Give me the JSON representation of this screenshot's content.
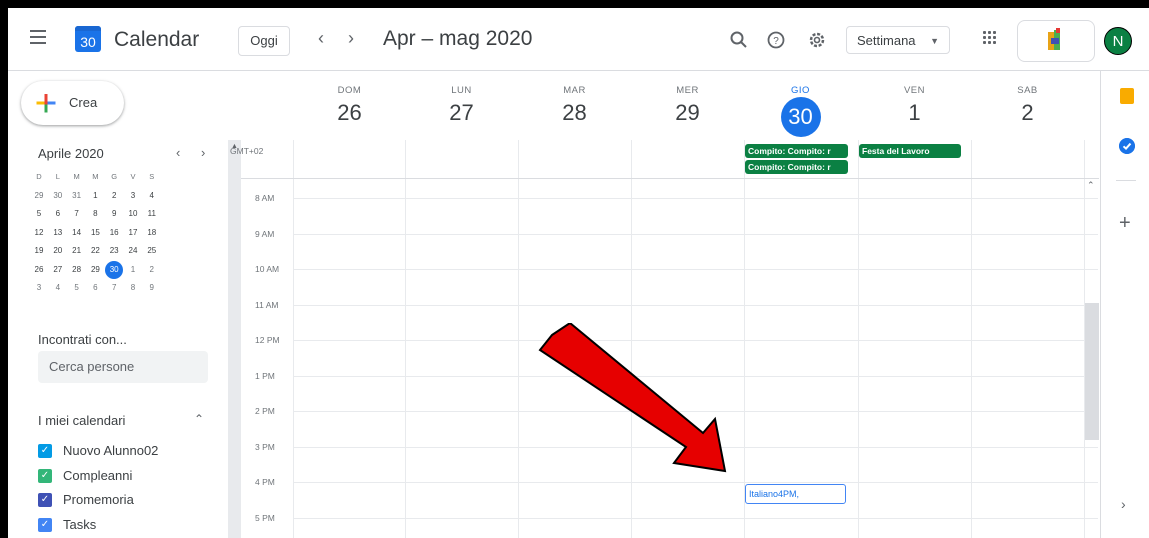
{
  "header": {
    "app_title": "Calendar",
    "logo_day": "30",
    "today_button": "Oggi",
    "prev_icon": "chevron-left-icon",
    "next_icon": "chevron-right-icon",
    "range_title": "Apr – mag 2020",
    "view_select": "Settimana",
    "avatar_letter": "N"
  },
  "sidebar": {
    "create_label": "Crea",
    "mini_month_title": "Aprile 2020",
    "mini_weekdays": [
      "D",
      "L",
      "M",
      "M",
      "G",
      "V",
      "S"
    ],
    "mini_weeks": [
      [
        "29",
        "30",
        "31",
        "1",
        "2",
        "3",
        "4"
      ],
      [
        "5",
        "6",
        "7",
        "8",
        "9",
        "10",
        "11"
      ],
      [
        "12",
        "13",
        "14",
        "15",
        "16",
        "17",
        "18"
      ],
      [
        "19",
        "20",
        "21",
        "22",
        "23",
        "24",
        "25"
      ],
      [
        "26",
        "27",
        "28",
        "29",
        "30",
        "1",
        "2"
      ],
      [
        "3",
        "4",
        "5",
        "6",
        "7",
        "8",
        "9"
      ]
    ],
    "meet_title": "Incontrati con...",
    "search_people_placeholder": "Cerca persone",
    "my_calendars_title": "I miei calendari",
    "calendars": [
      {
        "label": "Nuovo Alunno02",
        "color": "#039be5"
      },
      {
        "label": "Compleanni",
        "color": "#33b679"
      },
      {
        "label": "Promemoria",
        "color": "#3f51b5"
      },
      {
        "label": "Tasks",
        "color": "#4285f4"
      }
    ]
  },
  "week": {
    "days": [
      {
        "name": "DOM",
        "num": "26"
      },
      {
        "name": "LUN",
        "num": "27"
      },
      {
        "name": "MAR",
        "num": "28"
      },
      {
        "name": "MER",
        "num": "29"
      },
      {
        "name": "GIO",
        "num": "30",
        "today": true
      },
      {
        "name": "VEN",
        "num": "1"
      },
      {
        "name": "SAB",
        "num": "2"
      }
    ],
    "timezone": "GMT+02",
    "hours": [
      "8 AM",
      "9 AM",
      "10 AM",
      "11 AM",
      "12 PM",
      "1 PM",
      "2 PM",
      "3 PM",
      "4 PM",
      "5 PM"
    ],
    "allday_events": [
      {
        "day": "GIO",
        "title": "Compito: Compito: r"
      },
      {
        "day": "GIO",
        "title": "Compito: Compito: r"
      },
      {
        "day": "VEN",
        "title": "Festa del Lavoro"
      }
    ],
    "timed_events": [
      {
        "day": "GIO",
        "title": "Italiano4PM,"
      }
    ]
  },
  "colors": {
    "accent": "#1a73e8",
    "event_green": "#0b8043",
    "annotation_arrow": "#e60000"
  }
}
